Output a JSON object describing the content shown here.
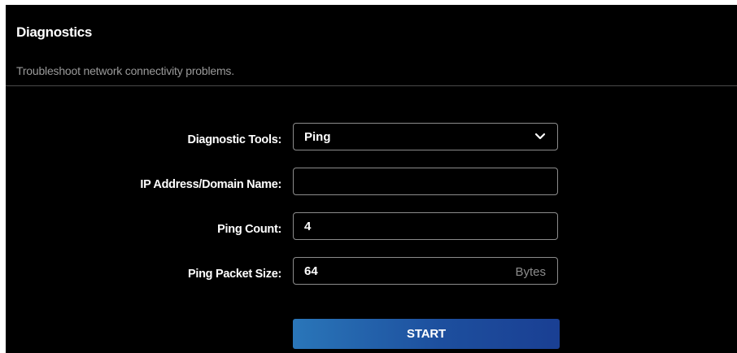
{
  "header": {
    "title": "Diagnostics",
    "description": "Troubleshoot network connectivity problems."
  },
  "form": {
    "diagnostic_tools": {
      "label": "Diagnostic Tools:",
      "selected": "Ping"
    },
    "ip_address": {
      "label": "IP Address/Domain Name:",
      "value": ""
    },
    "ping_count": {
      "label": "Ping Count:",
      "value": "4"
    },
    "packet_size": {
      "label": "Ping Packet Size:",
      "value": "64",
      "unit": "Bytes"
    }
  },
  "actions": {
    "start_label": "START"
  },
  "icons": {
    "dropdown": "chevron-down-icon"
  },
  "colors": {
    "background": "#000000",
    "text": "#ffffff",
    "muted_text": "#9a9a9a",
    "field_border": "#8c8c8c",
    "button_gradient_start": "#2a76b9",
    "button_gradient_end": "#1a3f93"
  }
}
